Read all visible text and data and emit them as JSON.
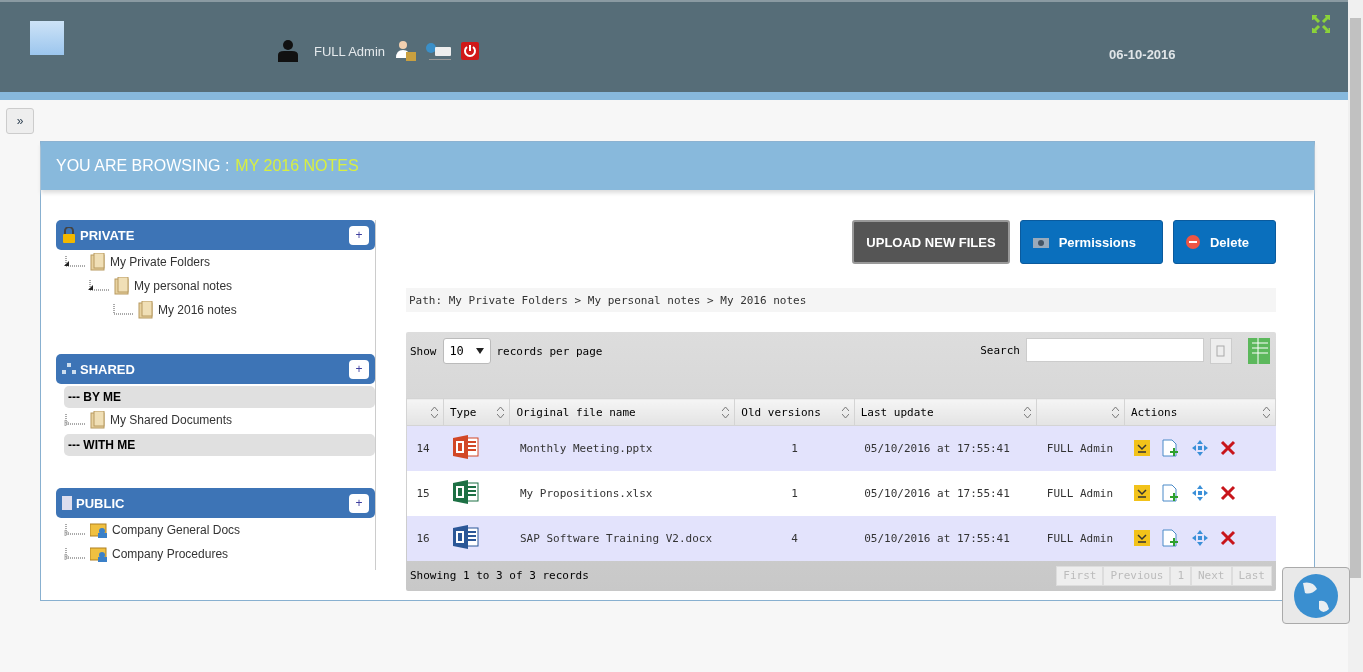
{
  "header": {
    "user": "FULL Admin",
    "date": "06-10-2016"
  },
  "toggle": "»",
  "panel": {
    "title": "YOU ARE BROWSING :",
    "current": "MY 2016 NOTES"
  },
  "sections": [
    {
      "kind": "private",
      "title": "PRIVATE",
      "add": "+",
      "groups": [
        {
          "items": [
            {
              "label": "My Private Folders",
              "expanded": true,
              "children": [
                {
                  "label": "My personal notes",
                  "expanded": true,
                  "children": [
                    {
                      "label": "My 2016 notes"
                    }
                  ]
                }
              ]
            }
          ]
        }
      ]
    },
    {
      "kind": "shared",
      "title": "SHARED",
      "add": "+",
      "groups": [
        {
          "label": "--- BY ME",
          "items": [
            {
              "label": "My Shared Documents",
              "expanded": false
            }
          ]
        },
        {
          "label": "--- WITH ME"
        }
      ]
    },
    {
      "kind": "public",
      "title": "PUBLIC",
      "add": "+",
      "groups": [
        {
          "items": [
            {
              "label": "Company General Docs",
              "kind": "shared-folder",
              "expanded": false
            },
            {
              "label": "Company Procedures",
              "kind": "shared-folder",
              "expanded": false
            }
          ]
        }
      ]
    }
  ],
  "buttons": [
    {
      "kind": "upload",
      "label": "UPLOAD NEW FILES"
    },
    {
      "kind": "permissions",
      "label": "Permissions"
    },
    {
      "kind": "delete",
      "label": "Delete"
    }
  ],
  "path": "Path: My Private Folders > My personal notes > My 2016 notes",
  "table": {
    "show": "Show",
    "page_size": "10",
    "per_page": "records per page",
    "search": "Search",
    "columns": [
      "",
      "Type",
      "Original file name",
      "Old versions",
      "Last update",
      "",
      "Actions"
    ],
    "rows": [
      {
        "id": "14",
        "kind": "powerpoint",
        "name": "Monthly Meeting.pptx",
        "versions": "1",
        "updated": "05/10/2016 at 17:55:41",
        "user": "FULL Admin"
      },
      {
        "id": "15",
        "kind": "excel",
        "name": "My Propositions.xlsx",
        "versions": "1",
        "updated": "05/10/2016 at 17:55:41",
        "user": "FULL Admin"
      },
      {
        "id": "16",
        "kind": "word",
        "name": "SAP Software Training V2.docx",
        "versions": "4",
        "updated": "05/10/2016 at 17:55:41",
        "user": "FULL Admin"
      }
    ],
    "info": "Showing 1 to 3 of 3 records",
    "pages": [
      {
        "label": "First",
        "disabled": true
      },
      {
        "label": "Previous",
        "disabled": true
      },
      {
        "label": "1",
        "disabled": true
      },
      {
        "label": "Next",
        "disabled": true
      },
      {
        "label": "Last",
        "disabled": true
      }
    ]
  }
}
